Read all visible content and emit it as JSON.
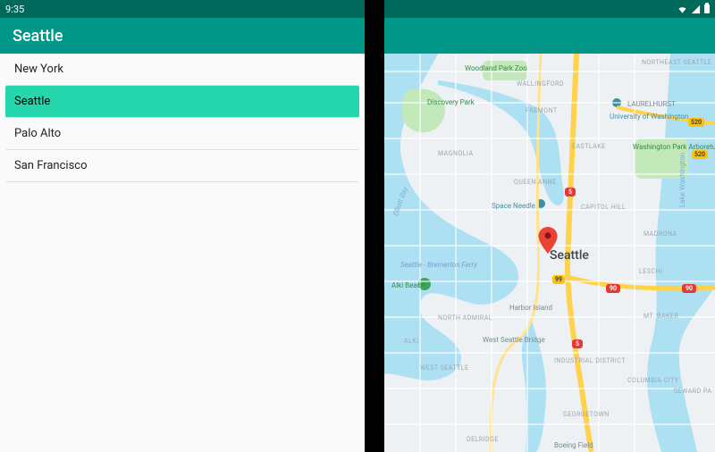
{
  "status": {
    "time": "9:35"
  },
  "appbar": {
    "title": "Seattle"
  },
  "list": {
    "items": [
      {
        "label": "New York"
      },
      {
        "label": "Seattle"
      },
      {
        "label": "Palo Alto"
      },
      {
        "label": "San Francisco"
      }
    ],
    "selected_index": 1
  },
  "map": {
    "city": "Seattle",
    "labels": {
      "woodland": "Woodland Park Zoo",
      "discovery": "Discovery Park",
      "wallingford": "WALLINGFORD",
      "fremont": "FREMONT",
      "ne_seattle": "NORTHEAST SEATTLE",
      "laurelhurst": "LAURELHURST",
      "uw": "University of Washington",
      "magnolia": "MAGNOLIA",
      "eastlake": "EASTLAKE",
      "wash_park": "Washington Park Arboretum UW Botanic",
      "queen_anne": "QUEEN ANNE",
      "space_needle": "Space Needle",
      "capitol_hill": "CAPITOL HILL",
      "madrona": "MADRONA",
      "ferry": "Seattle - Bremerton Ferry",
      "leschi": "LESCHI",
      "alki": "Alki Beach",
      "elliott_bay": "Elliott Bay",
      "north_admiral": "NORTH ADMIRAL",
      "alki_area": "ALKI",
      "harbor_island": "Harbor Island",
      "mt_baker": "MT. BAKER",
      "w_seattle_br": "West Seattle Bridge",
      "west_seattle": "WEST SEATTLE",
      "industrial": "INDUSTRIAL DISTRICT",
      "columbia": "COLUMBIA CITY",
      "seward": "SEWARD PA",
      "georgetown": "GEORGETOWN",
      "delridge": "DELRIDGE",
      "boeing": "Boeing Field",
      "lake_wa": "Lake Washington"
    },
    "shields": {
      "i5": "5",
      "i90": "90",
      "sr520a": "520",
      "sr520b": "520",
      "sr99": "99"
    }
  }
}
